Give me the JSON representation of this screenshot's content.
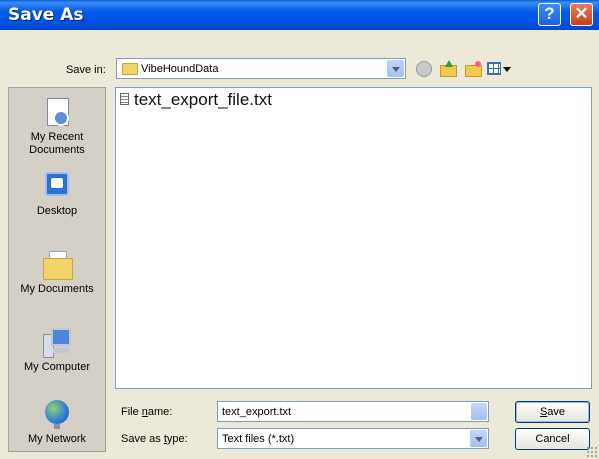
{
  "window": {
    "title": "Save As",
    "help_glyph": "?",
    "close_glyph": "✕"
  },
  "toolbar": {
    "lookin_label": "Save in:",
    "lookin_accesskey": "i",
    "lookin_value": "VibeHoundData",
    "icons": [
      "back-icon",
      "up-folder-icon",
      "new-folder-icon",
      "views-menu-icon"
    ]
  },
  "places": [
    {
      "label_line1": "My Recent",
      "label_line2": "Documents",
      "icon": "recent-documents-icon"
    },
    {
      "label_line1": "Desktop",
      "label_line2": "",
      "icon": "desktop-icon"
    },
    {
      "label_line1": "My Documents",
      "label_line2": "",
      "icon": "my-documents-icon"
    },
    {
      "label_line1": "My Computer",
      "label_line2": "",
      "icon": "my-computer-icon"
    },
    {
      "label_line1": "My Network",
      "label_line2": "",
      "icon": "network-icon"
    }
  ],
  "files": [
    {
      "name": "text_export_file.txt",
      "icon": "text-file-icon"
    }
  ],
  "form": {
    "filename_label_pre": "File ",
    "filename_label_key": "n",
    "filename_label_post": "ame:",
    "filename_value": "text_export.txt",
    "savetype_label_pre": "Save as ",
    "savetype_label_key": "t",
    "savetype_label_post": "ype:",
    "savetype_value": "Text files (*.txt)"
  },
  "buttons": {
    "save_key": "S",
    "save_rest": "ave",
    "cancel": "Cancel"
  }
}
